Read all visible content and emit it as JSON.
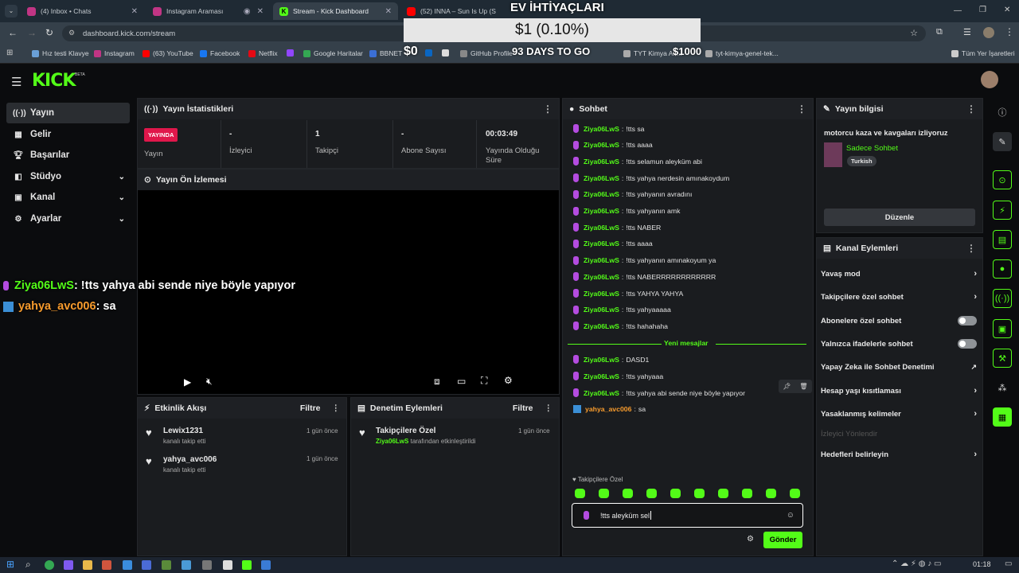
{
  "browser": {
    "tabs": [
      {
        "label": "(4) Inbox • Chats",
        "color": "#c13584"
      },
      {
        "label": "Instagram Araması",
        "color": "#c13584"
      },
      {
        "label": "Stream - Kick Dashboard",
        "color": "#53fc18"
      },
      {
        "label": "(52) INNA – Sun Is Up (Slow",
        "color": "#ff0000"
      }
    ],
    "url": "dashboard.kick.com/stream",
    "bookmarks": [
      "Hız testi Klavye",
      "Instagram",
      "(63) YouTube",
      "Facebook",
      "Netflix",
      "Google Haritalar",
      "BBNET",
      "GitHub Profile",
      "TYT Kimya Ak...",
      "tyt-kimya-genel-tek..."
    ],
    "bookmarks_right": "Tüm Yer İşaretleri"
  },
  "overlay": {
    "ev_title": "EV İHTİYAÇLARI",
    "donation": "$1 (0.10%)",
    "zero": "$0",
    "days": "93 DAYS TO GO",
    "thousand": "$1000",
    "msg1_user": "Ziya06LwS",
    "msg1_text": ": !tts yahya abi sende niye böyle yapıyor",
    "msg2_user": "yahya_avc006",
    "msg2_text": ": sa"
  },
  "app": {
    "logo": "KICK",
    "logo_sup": "BETA"
  },
  "sidebar": [
    {
      "label": "Yayın",
      "icon": "broadcast-icon"
    },
    {
      "label": "Gelir",
      "icon": "revenue-icon"
    },
    {
      "label": "Başarılar",
      "icon": "trophy-icon"
    },
    {
      "label": "Stüdyo",
      "icon": "studio-icon"
    },
    {
      "label": "Kanal",
      "icon": "channel-icon"
    },
    {
      "label": "Ayarlar",
      "icon": "settings-icon"
    }
  ],
  "stats": {
    "title": "Yayın İstatistikleri",
    "live_badge": "YAYINDA",
    "live_label": "Yayın",
    "viewers_value": "-",
    "viewers_label": "İzleyici",
    "followers_value": "1",
    "followers_label": "Takipçi",
    "subs_value": "-",
    "subs_label": "Abone Sayısı",
    "time_value": "00:03:49",
    "time_label": "Yayında Olduğu Süre"
  },
  "preview": {
    "title": "Yayın Ön İzlemesi"
  },
  "activity": {
    "title": "Etkinlik Akışı",
    "filter": "Filtre",
    "items": [
      {
        "name": "Lewix1231",
        "sub": "kanalı takip etti",
        "time": "1 gün önce"
      },
      {
        "name": "yahya_avc006",
        "sub": "kanalı takip etti",
        "time": "1 gün önce"
      }
    ]
  },
  "moderation": {
    "title": "Denetim Eylemleri",
    "filter": "Filtre",
    "item_name": "Takipçilere Özel",
    "item_user": "Ziya06LwS",
    "item_sub": "tarafından etkinleştirildi",
    "item_time": "1 gün önce"
  },
  "chat": {
    "title": "Sohbet",
    "messages": [
      {
        "user": "Ziya06LwS",
        "text": "!tts sa"
      },
      {
        "user": "Ziya06LwS",
        "text": "!tts aaaa"
      },
      {
        "user": "Ziya06LwS",
        "text": "!tts selamun aleyküm abi"
      },
      {
        "user": "Ziya06LwS",
        "text": "!tts yahya nerdesin amınakoydum"
      },
      {
        "user": "Ziya06LwS",
        "text": "!tts yahyanın avradını"
      },
      {
        "user": "Ziya06LwS",
        "text": "!tts yahyanın amk"
      },
      {
        "user": "Ziya06LwS",
        "text": "!tts NABER"
      },
      {
        "user": "Ziya06LwS",
        "text": "!tts aaaa"
      },
      {
        "user": "Ziya06LwS",
        "text": "!tts yahyanın amınakoyum ya"
      },
      {
        "user": "Ziya06LwS",
        "text": "!tts NABERRRRRRRRRRRR"
      },
      {
        "user": "Ziya06LwS",
        "text": "!tts YAHYA YAHYA"
      },
      {
        "user": "Ziya06LwS",
        "text": "!tts yahyaaaaa"
      },
      {
        "user": "Ziya06LwS",
        "text": "!tts hahahaha"
      }
    ],
    "divider": "Yeni mesajlar",
    "new_messages": [
      {
        "user": "Ziya06LwS",
        "text": "DASD1"
      },
      {
        "user": "Ziya06LwS",
        "text": "!tts yahyaaa"
      },
      {
        "user": "Ziya06LwS",
        "text": "!tts yahya abi sende niye böyle yapıyor"
      }
    ],
    "last_user": "yahya_avc006",
    "last_text": "sa",
    "followers_only": "Takipçilere Özel",
    "input_value": "!tts aleyküm sel",
    "send": "Gönder"
  },
  "stream_info": {
    "title": "Yayın bilgisi",
    "stream_title": "motorcu kaza ve kavgaları izliyoruz",
    "category": "Sadece Sohbet",
    "tag": "Turkish",
    "edit": "Düzenle"
  },
  "channel_actions": {
    "title": "Kanal Eylemleri",
    "items": [
      {
        "label": "Yavaş mod"
      },
      {
        "label": "Takipçilere özel sohbet"
      },
      {
        "label": "Abonelere özel sohbet"
      },
      {
        "label": "Yalnızca ifadelerle sohbet"
      },
      {
        "label": "Yapay Zeka ile Sohbet Denetimi"
      },
      {
        "label": "Hesap yaşı kısıtlaması"
      },
      {
        "label": "Yasaklanmış kelimeler"
      },
      {
        "label": "İzleyici Yönlendir"
      },
      {
        "label": "Hedefleri belirleyin"
      }
    ]
  },
  "taskbar": {
    "time": "01:18"
  }
}
